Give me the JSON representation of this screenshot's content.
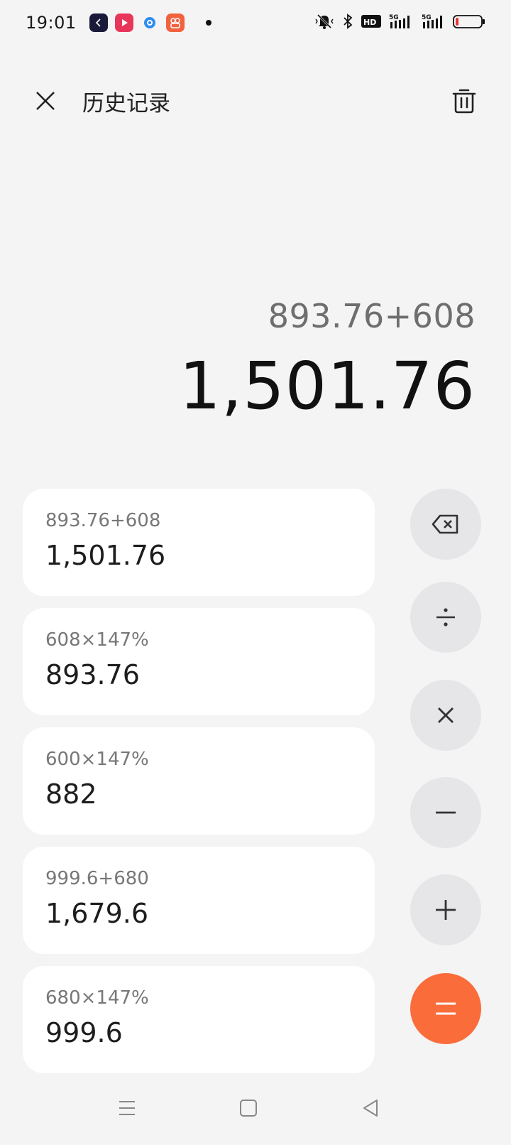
{
  "status_bar": {
    "time": "19:01",
    "app_icons": [
      "back-app-icon",
      "video-app-icon",
      "browser-app-icon",
      "camera-app-icon"
    ],
    "indicators": [
      "mute-bell-icon",
      "bluetooth-icon",
      "hd-icon",
      "signal-5g-icon",
      "signal-5g-icon",
      "battery-icon"
    ],
    "battery_level": 0.12
  },
  "header": {
    "title": "历史记录"
  },
  "display": {
    "expression": "893.76+608",
    "result": "1,501.76"
  },
  "history": [
    {
      "expression": "893.76+608",
      "result": "1,501.76"
    },
    {
      "expression": "608×147%",
      "result": "893.76"
    },
    {
      "expression": "600×147%",
      "result": "882"
    },
    {
      "expression": "999.6+680",
      "result": "1,679.6"
    },
    {
      "expression": "680×147%",
      "result": "999.6"
    }
  ],
  "operators": [
    "backspace",
    "divide",
    "multiply",
    "minus",
    "plus",
    "equals"
  ],
  "colors": {
    "background": "#f4f4f4",
    "card": "#ffffff",
    "operator": "#e6e6e8",
    "accent": "#fb6c3b",
    "battery_low": "#e53935"
  },
  "nav": [
    "menu-icon",
    "home-icon",
    "back-icon"
  ]
}
